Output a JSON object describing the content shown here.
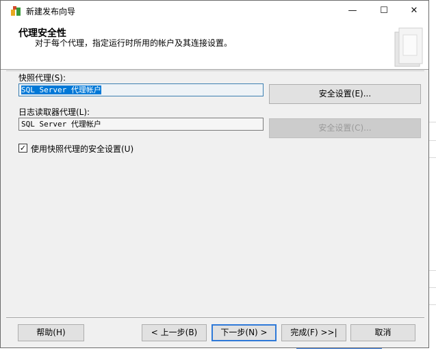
{
  "window": {
    "title": "新建发布向导",
    "controls": {
      "minimize": "—",
      "maximize": "☐",
      "close": "✕"
    }
  },
  "header": {
    "title": "代理安全性",
    "subtitle": "对于每个代理，指定运行时所用的帐户及其连接设置。"
  },
  "snapshot_agent": {
    "label": "快照代理(S):",
    "value": "SQL Server 代理帐户",
    "security_button": "安全设置(E)..."
  },
  "log_reader_agent": {
    "label": "日志读取器代理(L):",
    "value": "SQL Server 代理帐户",
    "security_button": "安全设置(C)..."
  },
  "use_snapshot_security": {
    "label": "使用快照代理的安全设置(U)",
    "checked": true,
    "mark": "✓"
  },
  "footer": {
    "help": "帮助(H)",
    "back": "< 上一步(B)",
    "next": "下一步(N) >",
    "finish": "完成(F) >>|",
    "cancel": "取消"
  },
  "colors": {
    "accent": "#2e79d8",
    "selection": "#0078d7"
  }
}
